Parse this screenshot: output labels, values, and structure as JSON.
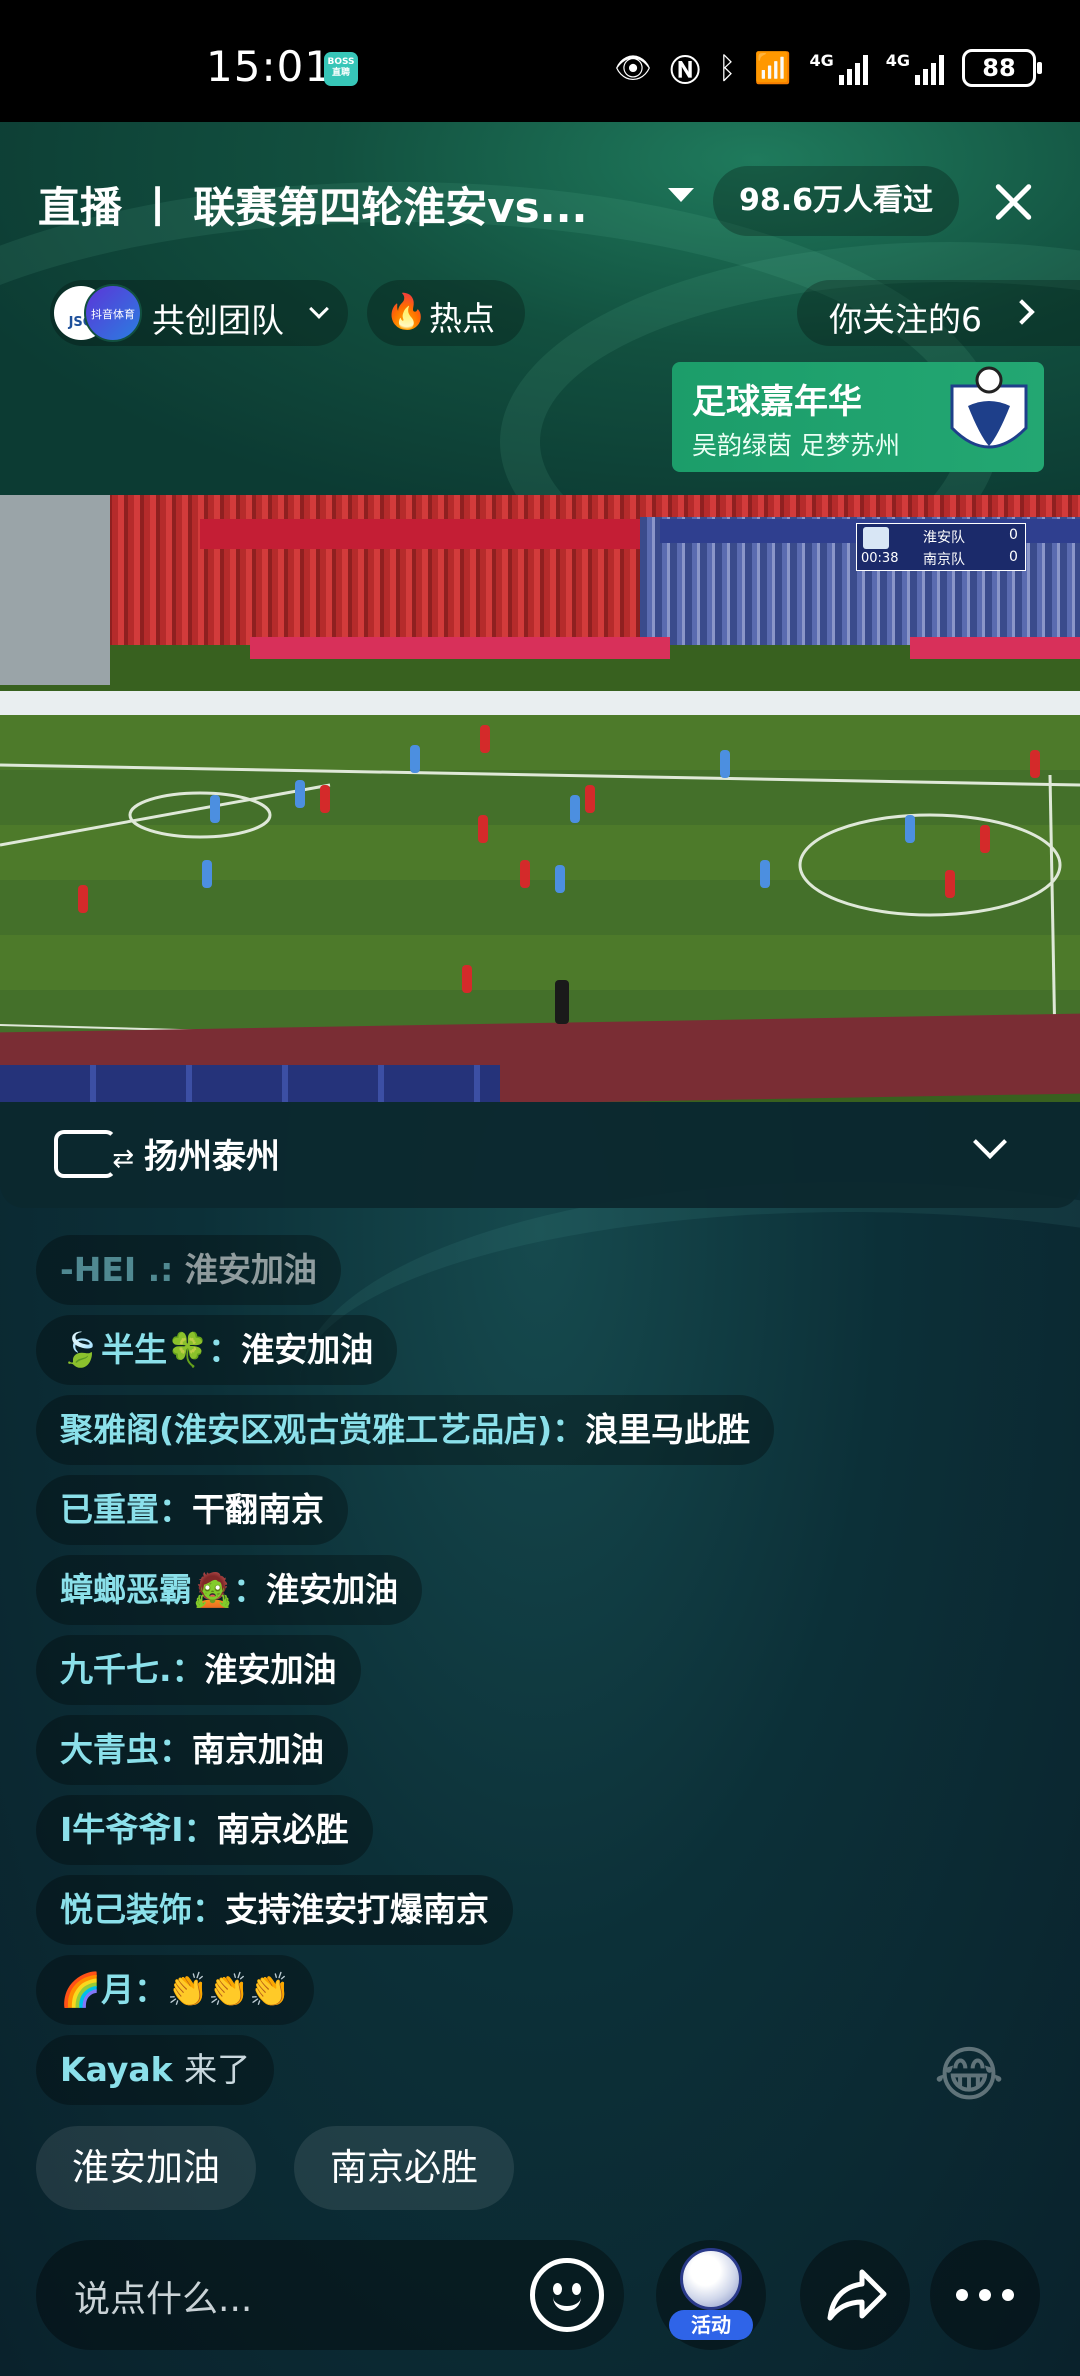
{
  "status_bar": {
    "time": "15:01",
    "boss_badge": "BOSS直聘",
    "network": "4G",
    "network2": "4G",
    "battery": "88"
  },
  "header": {
    "title": "直播 丨 联赛第四轮淮安vs...",
    "viewers": "98.6万人看过",
    "team_label": "共创团队",
    "avatar1": "JSG",
    "avatar2": "抖音体育",
    "hot_label": "热点",
    "follow_label": "你关注的6"
  },
  "banner": {
    "title": "足球嘉年华",
    "subtitle": "吴韵绿茵 足梦苏州"
  },
  "scoreboard": {
    "time": "00:38",
    "team1": "淮安队",
    "team2": "南京队",
    "score1": "0",
    "score2": "0"
  },
  "room": {
    "label": "扬州泰州"
  },
  "messages": [
    {
      "user": "-HEI                .: ",
      "text": "淮安加油"
    },
    {
      "user": "🍃半生🍀：",
      "text": "淮安加油"
    },
    {
      "user": "聚雅阁(淮安区观古赏雅工艺品店)：",
      "text": "浪里马此胜"
    },
    {
      "user": "已重置：",
      "text": "干翻南京"
    },
    {
      "user": "蟑螂恶霸🧟：",
      "text": "淮安加油"
    },
    {
      "user": "九千七.：",
      "text": "淮安加油"
    },
    {
      "user": "大青虫：",
      "text": "南京加油"
    },
    {
      "user": "I牛爷爷I：",
      "text": "南京必胜"
    },
    {
      "user": "悦己装饰：",
      "text": "支持淮安打爆南京"
    },
    {
      "user": "🌈月：",
      "text": "👏👏👏"
    },
    {
      "user": "Kayak",
      "text": "来了"
    }
  ],
  "quick_replies": [
    "淮安加油",
    "南京必胜"
  ],
  "input": {
    "placeholder": "说点什么..."
  },
  "activity_label": "活动",
  "icons": {
    "close": "close-icon",
    "caret": "caret-down-icon",
    "hot": "flame-icon",
    "room": "switch-screen-icon",
    "emoji": "smile-icon",
    "share": "share-icon",
    "more": "more-icon"
  }
}
